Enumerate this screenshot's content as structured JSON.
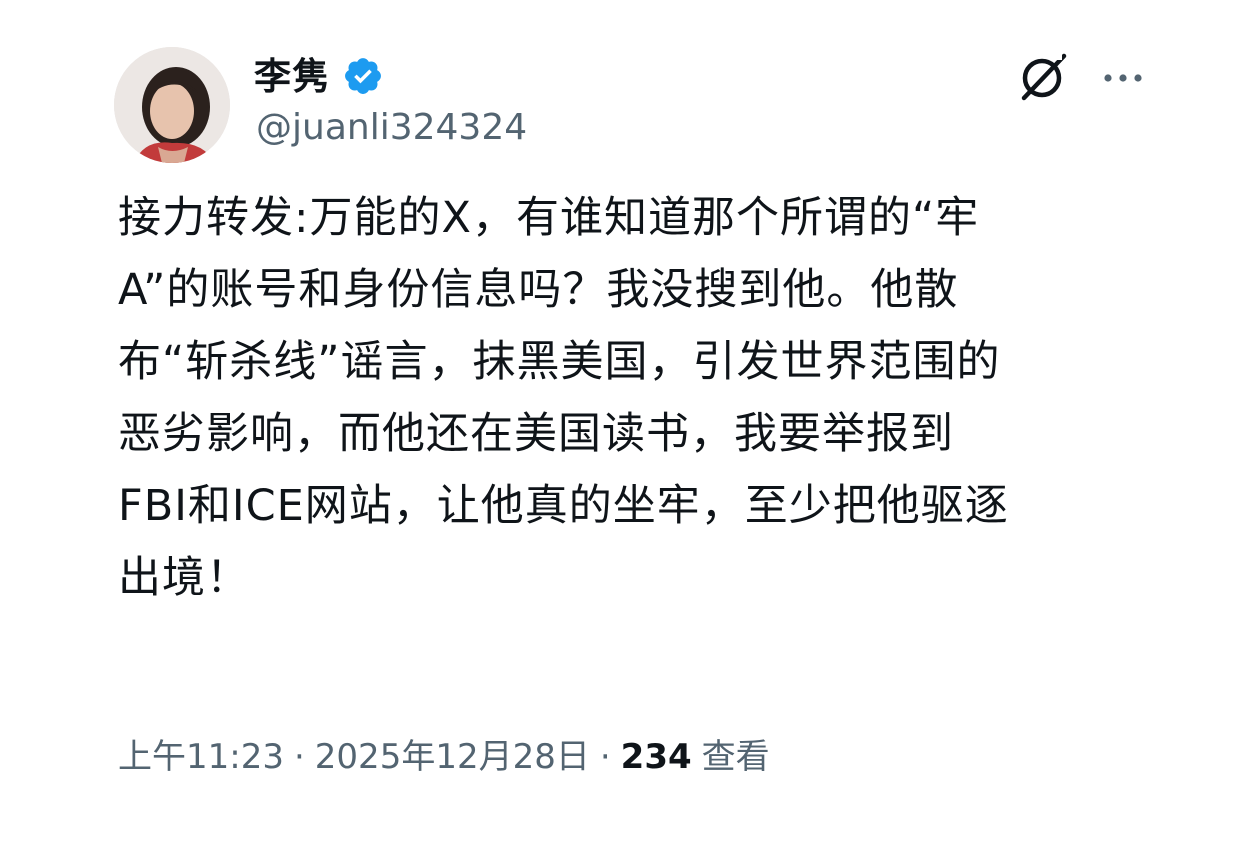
{
  "author": {
    "display_name": "李隽",
    "handle": "@juanli324324",
    "verified": true
  },
  "post": {
    "lines": [
      "接力转发:万能的X，有谁知道那个所谓的“牢",
      "A”的账号和身份信息吗？我没搜到他。他散",
      "布“斩杀线”谣言，抹黑美国，引发世界范围的",
      "恶劣影响，而他还在美国读书，我要举报到",
      "FBI和ICE网站，让他真的坐牢，至少把他驱逐",
      "出境！"
    ]
  },
  "meta": {
    "time": "上午11:23",
    "separator": "·",
    "date": "2025年12月28日",
    "views_count": "234",
    "views_label": "查看"
  },
  "icons": {
    "grok": "grok-icon",
    "more": "more-icon",
    "verified": "verified-badge-icon"
  },
  "colors": {
    "verified_blue": "#1d9bf0",
    "text_primary": "#0f1419",
    "text_secondary": "#536471"
  }
}
